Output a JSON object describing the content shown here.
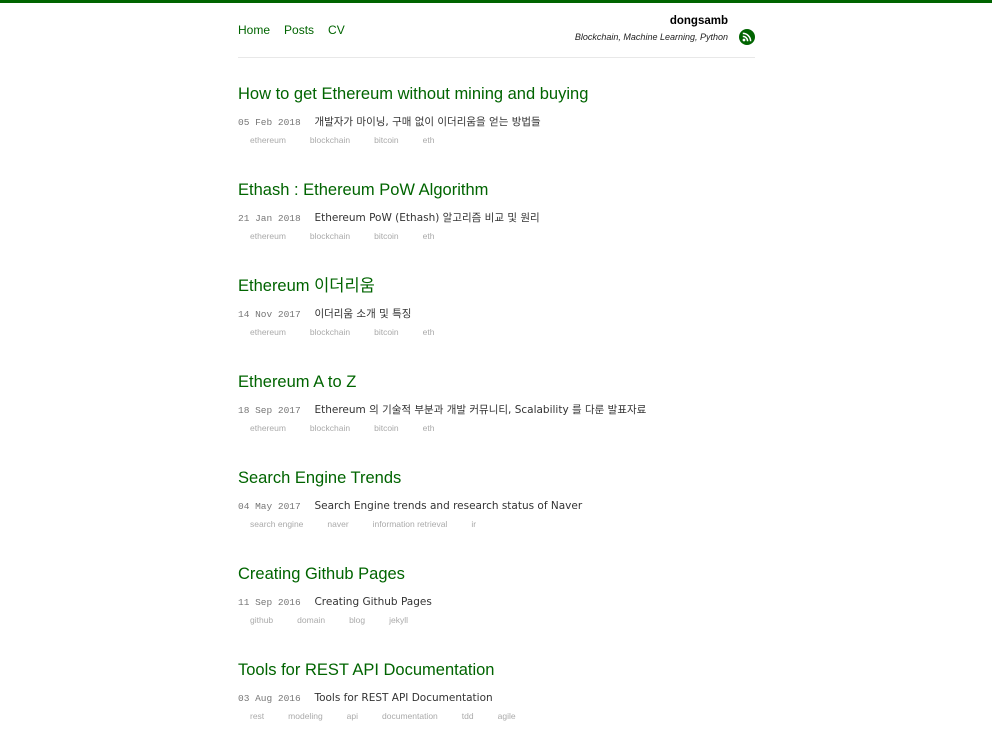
{
  "nav": {
    "items": [
      "Home",
      "Posts",
      "CV"
    ]
  },
  "site": {
    "name": "dongsamb",
    "description": "Blockchain, Machine Learning, Python",
    "rss_icon": "rss-icon"
  },
  "colors": {
    "accent": "#006400",
    "tag": "#aaaaaa",
    "date": "#777777"
  },
  "posts": [
    {
      "title": "How to get Ethereum without mining and buying",
      "date": "05 Feb 2018",
      "description": "개발자가 마이닝, 구매 없이 이더리움을 얻는 방법들",
      "tags": [
        "ethereum",
        "blockchain",
        "bitcoin",
        "eth"
      ]
    },
    {
      "title": "Ethash : Ethereum PoW Algorithm",
      "date": "21 Jan 2018",
      "description": "Ethereum PoW (Ethash) 알고리즘 비교 및 원리",
      "tags": [
        "ethereum",
        "blockchain",
        "bitcoin",
        "eth"
      ]
    },
    {
      "title": "Ethereum 이더리움",
      "date": "14 Nov 2017",
      "description": "이더리움 소개 및 특징",
      "tags": [
        "ethereum",
        "blockchain",
        "bitcoin",
        "eth"
      ]
    },
    {
      "title": "Ethereum A to Z",
      "date": "18 Sep 2017",
      "description": "Ethereum 의 기술적 부분과 개발 커뮤니티, Scalability 를 다룬 발표자료",
      "tags": [
        "ethereum",
        "blockchain",
        "bitcoin",
        "eth"
      ]
    },
    {
      "title": "Search Engine Trends",
      "date": "04 May 2017",
      "description": "Search Engine trends and research status of Naver",
      "tags": [
        "search engine",
        "naver",
        "information retrieval",
        "ir"
      ]
    },
    {
      "title": "Creating Github Pages",
      "date": "11 Sep 2016",
      "description": "Creating Github Pages",
      "tags": [
        "github",
        "domain",
        "blog",
        "jekyll"
      ]
    },
    {
      "title": "Tools for REST API Documentation",
      "date": "03 Aug 2016",
      "description": "Tools for REST API Documentation",
      "tags": [
        "rest",
        "modeling",
        "api",
        "documentation",
        "tdd",
        "agile"
      ]
    }
  ]
}
